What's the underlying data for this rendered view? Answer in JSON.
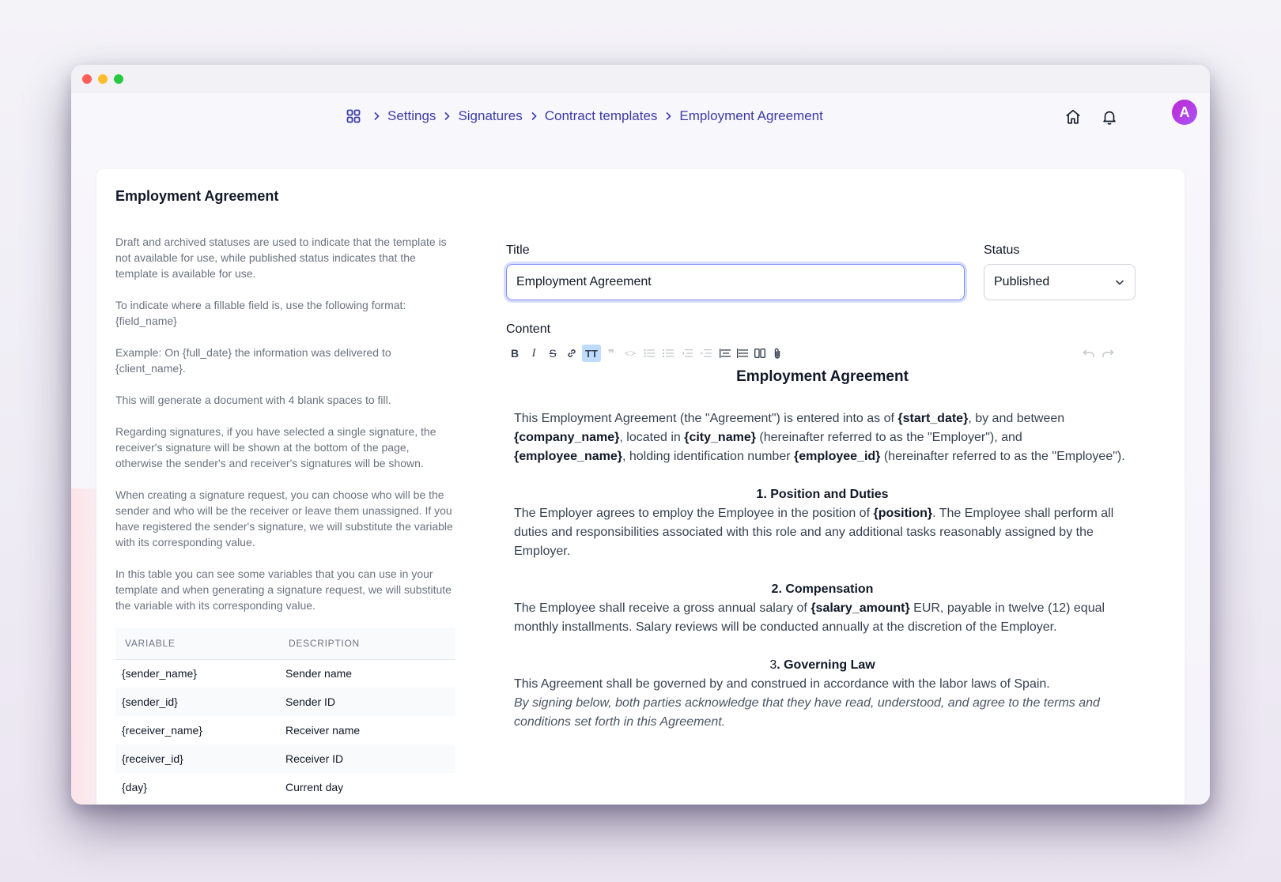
{
  "breadcrumb": {
    "items": [
      "Settings",
      "Signatures",
      "Contract templates",
      "Employment Agreement"
    ]
  },
  "card": {
    "title": "Employment Agreement",
    "help": [
      "Draft and archived statuses are used to indicate that the template is not available for use, while published status indicates that the template is available for use.",
      "To indicate where a fillable field is, use the following format: {field_name}",
      "Example: On {full_date} the information was delivered to {client_name}.",
      "This will generate a document with 4 blank spaces to fill.",
      "Regarding signatures, if you have selected a single signature, the receiver's signature will be shown at the bottom of the page, otherwise the sender's and receiver's signatures will be shown.",
      "When creating a signature request, you can choose who will be the sender and who will be the receiver or leave them unassigned. If you have registered the sender's signature, we will substitute the variable with its corresponding value.",
      "In this table you can see some variables that you can use in your template and when generating a signature request, we will substitute the variable with its corresponding value."
    ],
    "table": {
      "headers": [
        "VARIABLE",
        "DESCRIPTION"
      ],
      "rows": [
        [
          "{sender_name}",
          "Sender name"
        ],
        [
          "{sender_id}",
          "Sender ID"
        ],
        [
          "{receiver_name}",
          "Receiver name"
        ],
        [
          "{receiver_id}",
          "Receiver ID"
        ],
        [
          "{day}",
          "Current day"
        ]
      ]
    }
  },
  "form": {
    "title_label": "Title",
    "title_value": "Employment Agreement",
    "status_label": "Status",
    "status_value": "Published",
    "content_label": "Content"
  },
  "document": {
    "heading": "Employment Agreement",
    "intro": {
      "t1": "This Employment Agreement (the \"Agreement\") is entered into as of ",
      "v1": "{start_date}",
      "t2": ", by and between ",
      "v2": "{company_name}",
      "t3": ", located in ",
      "v3": "{city_name}",
      "t4": " (hereinafter referred to as the \"Employer\"), and ",
      "v4": "{employee_name}",
      "t5": ", holding identification number ",
      "v5": "{employee_id}",
      "t6": " (hereinafter referred to as the \"Employee\")."
    },
    "s1": {
      "heading": "1. Position and Duties",
      "t1": "The Employer agrees to employ the Employee in the position of ",
      "v1": "{position}",
      "t2": ". The Employee shall perform all duties and responsibilities associated with this role and any additional tasks reasonably assigned by the Employer."
    },
    "s2": {
      "heading": "2. Compensation",
      "t1": "The Employee shall receive a gross annual salary of ",
      "v1": "{salary_amount}",
      "t2": " EUR, payable in twelve (12) equal monthly installments. Salary reviews will be conducted annually at the discretion of the Employer."
    },
    "s3": {
      "num": "3",
      "heading": ". Governing Law",
      "body": "This Agreement shall be governed by and construed in accordance with the labor laws of Spain.",
      "closing": "By signing below, both parties acknowledge that they have read, understood, and agree to the terms and conditions set forth in this Agreement."
    }
  },
  "user": {
    "avatar_initial": "A"
  },
  "colors": {
    "accent": "#3b3ba8",
    "avatar": "#c026d3",
    "focus": "#818cf8"
  }
}
